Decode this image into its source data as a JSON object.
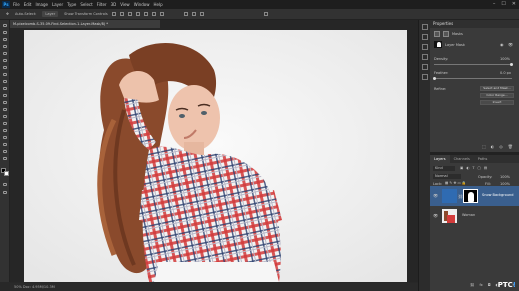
{
  "menubar": {
    "app_icon": "Ps",
    "items": [
      "File",
      "Edit",
      "Image",
      "Layer",
      "Type",
      "Select",
      "Filter",
      "3D",
      "View",
      "Window",
      "Help"
    ],
    "window_controls": [
      "–",
      "☐",
      "✕"
    ]
  },
  "options_bar": {
    "auto_select_label": "Auto-Select:",
    "auto_select_value": "Layer",
    "transform_label": "Show Transform Controls"
  },
  "document": {
    "tab_title": "M-pixelcomb-S-35.09-Find-Selection-1-Layer-Mask/8) *",
    "zoom_status": "50%  Doc: 4.95M/10.3M"
  },
  "properties": {
    "title": "Properties",
    "subtitle": "Masks",
    "mask_label": "Layer Mask",
    "density_label": "Density:",
    "density_value": "100%",
    "feather_label": "Feather:",
    "feather_value": "0.0 px",
    "refine_label": "Refine:",
    "select_and_mask": "Select and Mask...",
    "color_range": "Color Range...",
    "invert": "Invert"
  },
  "layers_panel": {
    "tabs": [
      "Layers",
      "Channels",
      "Paths"
    ],
    "filter_label": "Kind",
    "blend_mode": "Normal",
    "opacity_label": "Opacity:",
    "opacity_value": "100%",
    "lock_label": "Lock:",
    "fill_label": "Fill:",
    "fill_value": "100%",
    "layers": [
      {
        "name": "Snow Background"
      },
      {
        "name": "Woman"
      }
    ]
  },
  "watermark": {
    "text_a": "PTC",
    "text_b": "!"
  },
  "colors": {
    "accent": "#31a8ff",
    "selected_layer": "#3a5f8e",
    "panel": "#3a3a3a"
  }
}
